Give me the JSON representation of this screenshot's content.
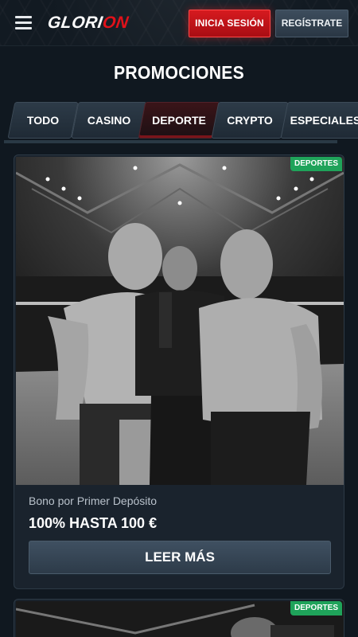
{
  "header": {
    "logo_main": "GLORI",
    "logo_accent": "ON",
    "login_label": "INICIA SESIÓN",
    "register_label": "REGÍSTRATE",
    "accent_color": "#e1111a"
  },
  "page": {
    "title": "PROMOCIONES"
  },
  "tabs": [
    {
      "label": "TODO",
      "active": false
    },
    {
      "label": "CASINO",
      "active": false
    },
    {
      "label": "DEPORTE",
      "active": true
    },
    {
      "label": "CRYPTO",
      "active": false
    },
    {
      "label": "ESPECIALES",
      "active": false
    }
  ],
  "promos": [
    {
      "badge": "DEPORTES",
      "image": "mma-fighters-faceoff-photo",
      "subtitle": "Bono por Primer Depósito",
      "title": "100% HASTA 100 €",
      "button_label": "LEER MÁS",
      "badge_color": "#1fa35a"
    },
    {
      "badge": "DEPORTES",
      "image": "arena-photo"
    }
  ]
}
